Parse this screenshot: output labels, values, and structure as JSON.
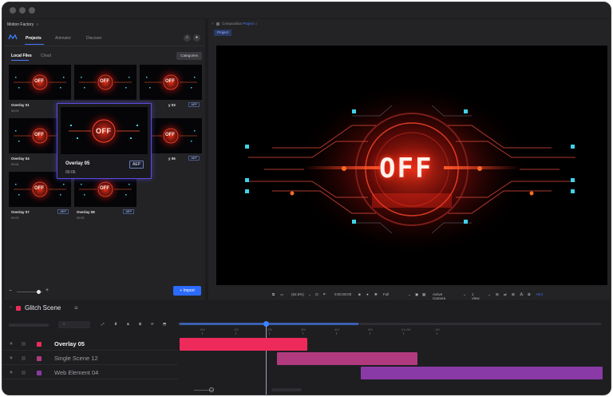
{
  "colors": {
    "accent": "#2b6bff",
    "selection": "#5a4be0",
    "track1": "#ee2a5b",
    "track2": "#b13a7e",
    "track3": "#8a3aa6"
  },
  "app": {
    "title": "Motion Factory",
    "menu_glyph": "≡"
  },
  "nav": {
    "tabs": [
      {
        "label": "Projects"
      },
      {
        "label": "Animator"
      },
      {
        "label": "Discover"
      }
    ],
    "search_icon": "search-icon",
    "user_icon": "user-icon"
  },
  "library": {
    "subtabs": [
      {
        "label": "Local Files"
      },
      {
        "label": "Cloud"
      }
    ],
    "categories_label": "Categories",
    "cards": [
      {
        "title": "Overlay 01",
        "time": "00:03",
        "badge": ""
      },
      {
        "title": "",
        "time": "",
        "badge": ""
      },
      {
        "title": "y 03",
        "time": "",
        "badge": "AEP"
      },
      {
        "title": "Overlay 04",
        "time": "00:04",
        "badge": ""
      },
      {
        "title": "y 06",
        "time": "",
        "badge": "AEP"
      },
      {
        "title": "Overlay 07",
        "time": "00:03",
        "badge": "AEP"
      },
      {
        "title": "Overlay 08",
        "time": "00:05",
        "badge": "AEP"
      }
    ],
    "preview_popup": {
      "title": "Overlay 05",
      "time": "00:06",
      "badge": "AEP"
    },
    "zoom_minus": "−",
    "zoom_plus": "+",
    "import_label": "+ Import",
    "thumb_text": "OFF"
  },
  "composition": {
    "breadcrumb_prefix": "Composition",
    "breadcrumb_name": "Project",
    "tab_label": "Project",
    "preview_text": "OFF",
    "controls": {
      "zoom": "(62.6%)",
      "timecode": "0:00:00:00",
      "resolution": "Full",
      "camera": "Active Camera",
      "views": "1 View",
      "exposure": "+0.0"
    }
  },
  "timeline": {
    "scene_name": "Glitch Scene",
    "ruler": [
      "00f",
      "10f",
      "20f",
      "30f",
      "40f",
      "50f",
      "01:00f",
      "10f"
    ],
    "tracks": [
      {
        "name": "Overlay 05",
        "active": true
      },
      {
        "name": "Single Scene 12",
        "active": false
      },
      {
        "name": "Web Element 04",
        "active": false
      }
    ]
  }
}
